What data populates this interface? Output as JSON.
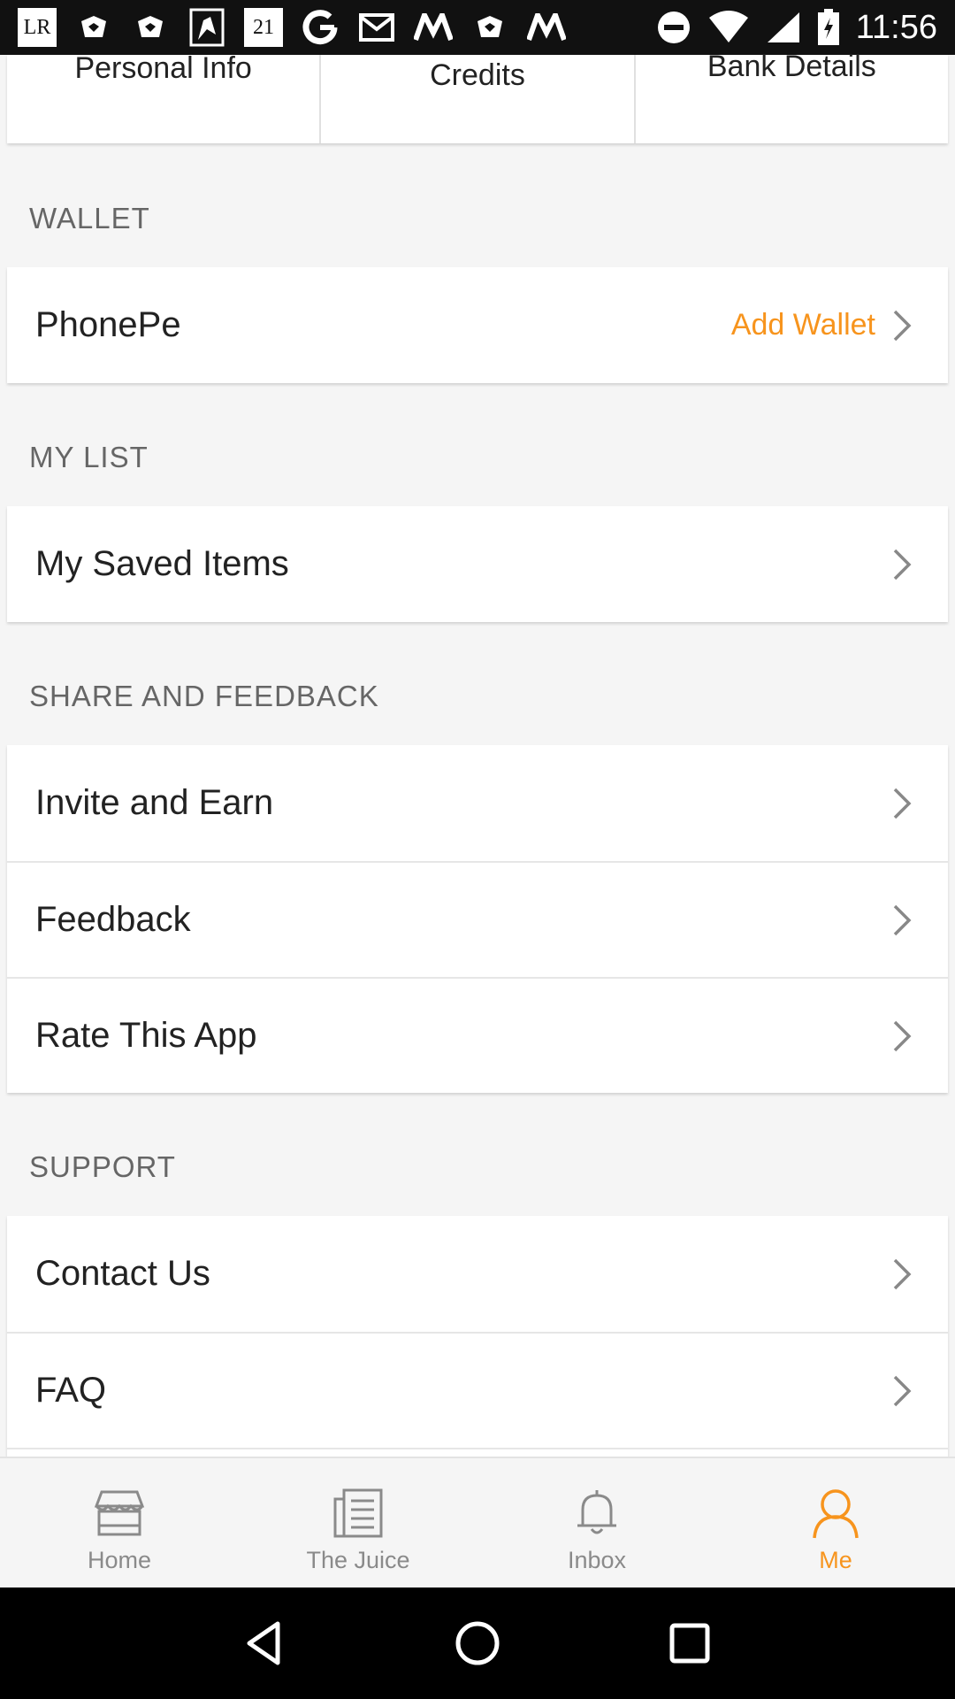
{
  "status_bar": {
    "left_icons": [
      "lr-app-icon",
      "notification-icon",
      "notification-icon",
      "notification-icon",
      "calendar-icon",
      "google-icon",
      "gmail-icon",
      "myntra-icon",
      "notification-icon",
      "myntra-icon"
    ],
    "lr_text": "LR",
    "calendar_text": "21",
    "time": "11:56"
  },
  "tabs": [
    {
      "label": "Personal Info"
    },
    {
      "label": "Credits"
    },
    {
      "label": "Bank Details"
    }
  ],
  "sections": {
    "wallet": {
      "title": "WALLET",
      "items": [
        {
          "label": "PhonePe",
          "action": "Add Wallet"
        }
      ]
    },
    "my_list": {
      "title": "MY LIST",
      "items": [
        {
          "label": "My Saved Items"
        }
      ]
    },
    "share": {
      "title": "SHARE AND FEEDBACK",
      "items": [
        {
          "label": "Invite and Earn"
        },
        {
          "label": "Feedback"
        },
        {
          "label": "Rate This App"
        }
      ]
    },
    "support": {
      "title": "SUPPORT",
      "items": [
        {
          "label": "Contact Us"
        },
        {
          "label": "FAQ"
        }
      ]
    }
  },
  "bottom_nav": {
    "items": [
      {
        "label": "Home",
        "icon": "store-icon"
      },
      {
        "label": "The Juice",
        "icon": "news-icon"
      },
      {
        "label": "Inbox",
        "icon": "bell-icon"
      },
      {
        "label": "Me",
        "icon": "person-icon",
        "active": true
      }
    ]
  },
  "colors": {
    "accent": "#f7941d",
    "text": "#222222",
    "muted": "#8a8a8a"
  }
}
